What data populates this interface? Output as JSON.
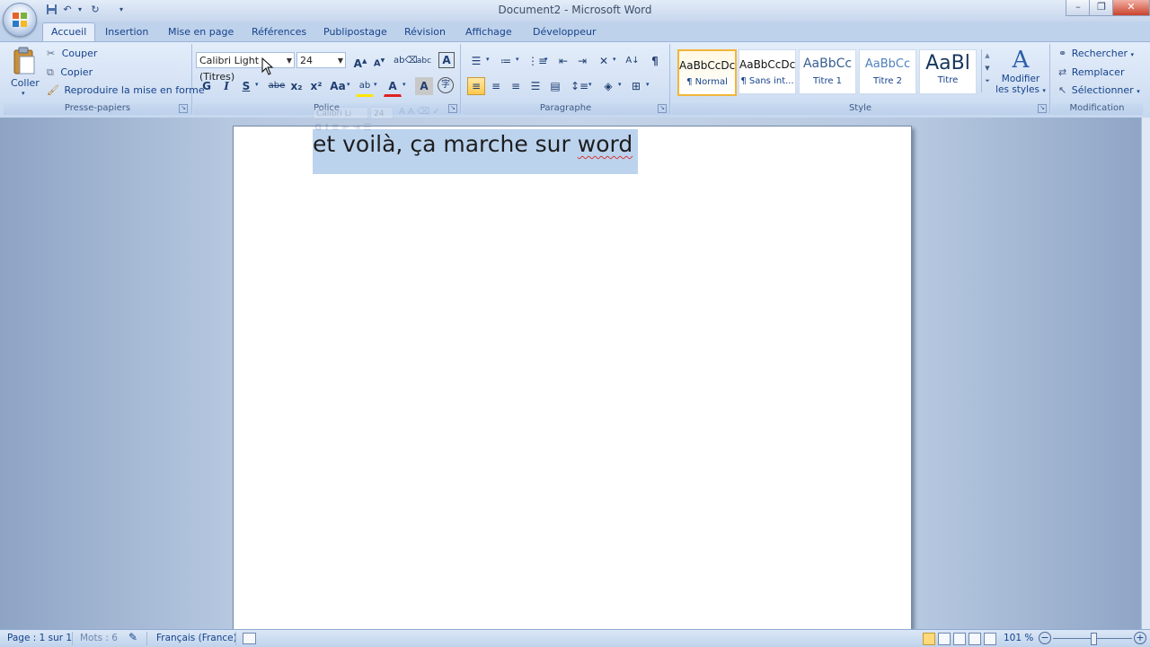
{
  "window": {
    "title": "Document2 - Microsoft Word"
  },
  "tabs": [
    "Accueil",
    "Insertion",
    "Mise en page",
    "Références",
    "Publipostage",
    "Révision",
    "Affichage",
    "Développeur"
  ],
  "clipboard": {
    "paste_label": "Coller",
    "cut": "Couper",
    "copy": "Copier",
    "format_painter": "Reproduire la mise en forme",
    "group": "Presse-papiers"
  },
  "font": {
    "name": "Calibri Light (Titres)",
    "size": "24",
    "group": "Police",
    "bold": "G",
    "italic": "I",
    "underline": "S",
    "strike": "abe",
    "subscript": "x₂",
    "superscript": "x²",
    "case": "Aa"
  },
  "paragraph": {
    "group": "Paragraphe",
    "pilcrow": "¶"
  },
  "styles": {
    "group": "Style",
    "items": [
      {
        "sample": "AaBbCcDc",
        "name": "¶ Normal"
      },
      {
        "sample": "AaBbCcDc",
        "name": "¶ Sans int..."
      },
      {
        "sample": "AaBbCc",
        "name": "Titre 1"
      },
      {
        "sample": "AaBbCc",
        "name": "Titre 2"
      },
      {
        "sample": "AaBl",
        "name": "Titre"
      }
    ],
    "modify_line1": "Modifier",
    "modify_line2": "les styles"
  },
  "editing": {
    "group": "Modification",
    "find": "Rechercher",
    "replace": "Remplacer",
    "select": "Sélectionner"
  },
  "document": {
    "text_before": "et voilà, ça marche sur ",
    "text_misspelled": "word"
  },
  "minitoolbar": {
    "font": "Calibri Li",
    "size": "24"
  },
  "status": {
    "page": "Page : 1 sur 1",
    "words": "Mots : 6",
    "language": "Français (France)",
    "zoom": "101 %"
  },
  "colors": {
    "accent": "#15428b",
    "ribbon": "#d6e3f5",
    "selection": "#bcd3ee",
    "highlight": "#ffc84a"
  },
  "icons": [
    "office-logo-icon",
    "save-icon",
    "undo-icon",
    "redo-icon",
    "paste-icon",
    "scissors-icon",
    "copy-icon",
    "brush-icon",
    "grow-font-icon",
    "shrink-font-icon",
    "clear-format-icon",
    "bullets-icon",
    "numbering-icon",
    "multilevel-icon",
    "decrease-indent-icon",
    "increase-indent-icon",
    "sort-icon",
    "pilcrow-icon",
    "align-left-icon",
    "align-center-icon",
    "align-right-icon",
    "justify-icon",
    "line-spacing-icon",
    "shading-icon",
    "borders-icon",
    "binoculars-icon",
    "replace-icon",
    "select-icon",
    "spellcheck-icon",
    "macro-icon"
  ]
}
